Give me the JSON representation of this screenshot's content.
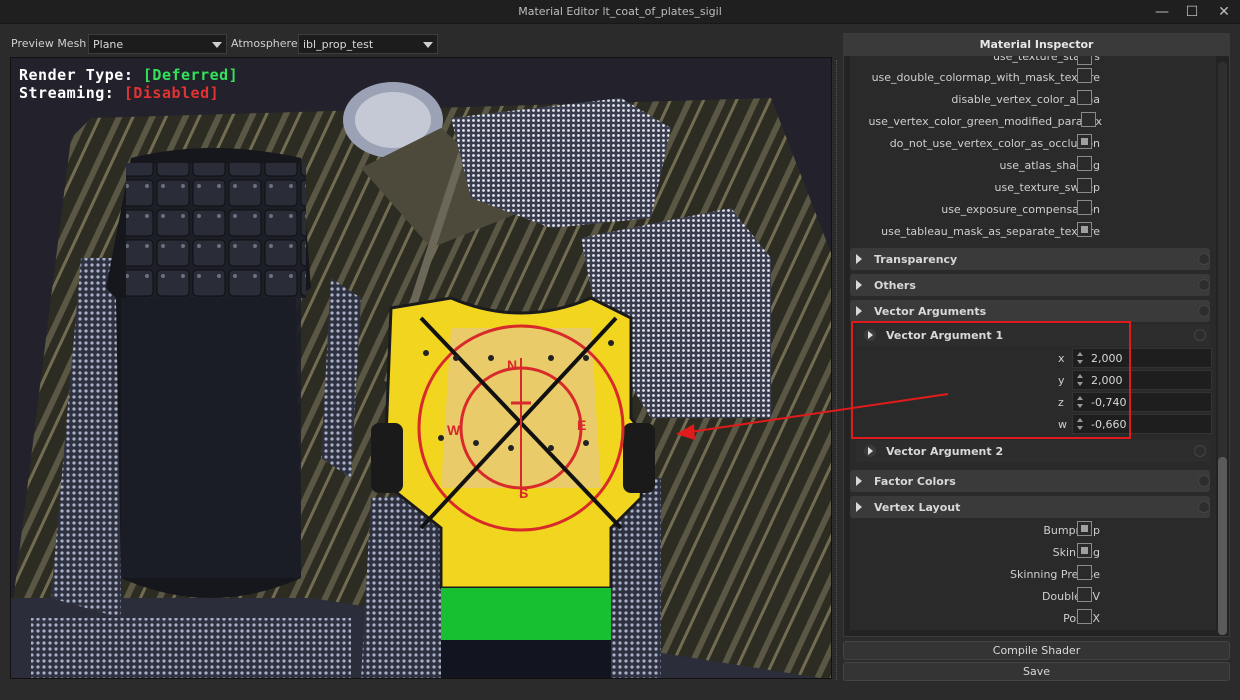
{
  "window": {
    "title": "Material Editor lt_coat_of_plates_sigil",
    "minimize_glyph": "—",
    "maximize_glyph": "☐",
    "close_glyph": "✕"
  },
  "toolbar": {
    "preview_mesh_label": "Preview Mesh",
    "preview_mesh_value": "Plane",
    "atmosphere_label": "Atmosphere",
    "atmosphere_value": "ibl_prop_test"
  },
  "viewport": {
    "render_type_label": "Render Type: ",
    "render_type_value": "[Deferred]",
    "streaming_label": "Streaming: ",
    "streaming_value": "[Disabled]",
    "compass": {
      "n": "N",
      "s": "S",
      "e": "E",
      "w": "W"
    }
  },
  "inspector": {
    "title": "Material Inspector",
    "flags": [
      {
        "label": "use_texture_stalers",
        "checked": false
      },
      {
        "label": "use_double_colormap_with_mask_texture",
        "checked": false
      },
      {
        "label": "disable_vertex_color_alpha",
        "checked": false
      },
      {
        "label": "use_vertex_color_green_modified_parallax",
        "checked": false
      },
      {
        "label": "do_not_use_vertex_color_as_occlusion",
        "checked": true
      },
      {
        "label": "use_atlas_shading",
        "checked": false
      },
      {
        "label": "use_texture_sweep",
        "checked": false
      },
      {
        "label": "use_exposure_compensation",
        "checked": false
      },
      {
        "label": "use_tableau_mask_as_separate_texture",
        "checked": true
      }
    ],
    "sections": {
      "transparency": "Transparency",
      "others": "Others",
      "vector_arguments": "Vector Arguments",
      "factor_colors": "Factor Colors",
      "vertex_layout": "Vertex Layout"
    },
    "vector_argument_1": {
      "title": "Vector Argument 1",
      "x_label": "x",
      "x": "2,000",
      "y_label": "y",
      "y": "2,000",
      "z_label": "z",
      "z": "-0,740",
      "w_label": "w",
      "w": "-0,660"
    },
    "vector_argument_2": {
      "title": "Vector Argument 2"
    },
    "vertex_layout_flags": [
      {
        "label": "Bumpmap",
        "checked": true
      },
      {
        "label": "Skinning",
        "checked": true
      },
      {
        "label": "Skinning Precise",
        "checked": false
      },
      {
        "label": "Double UV",
        "checked": false
      },
      {
        "label": "PostFX",
        "checked": false
      }
    ]
  },
  "buttons": {
    "compile_shader": "Compile Shader",
    "save": "Save"
  },
  "colors": {
    "annotation_red": "#e01b1b",
    "deferred_green": "#33e25a",
    "disabled_red": "#e23333",
    "tunic_yellow": "#f2d51f",
    "stripe_green": "#16c030"
  }
}
